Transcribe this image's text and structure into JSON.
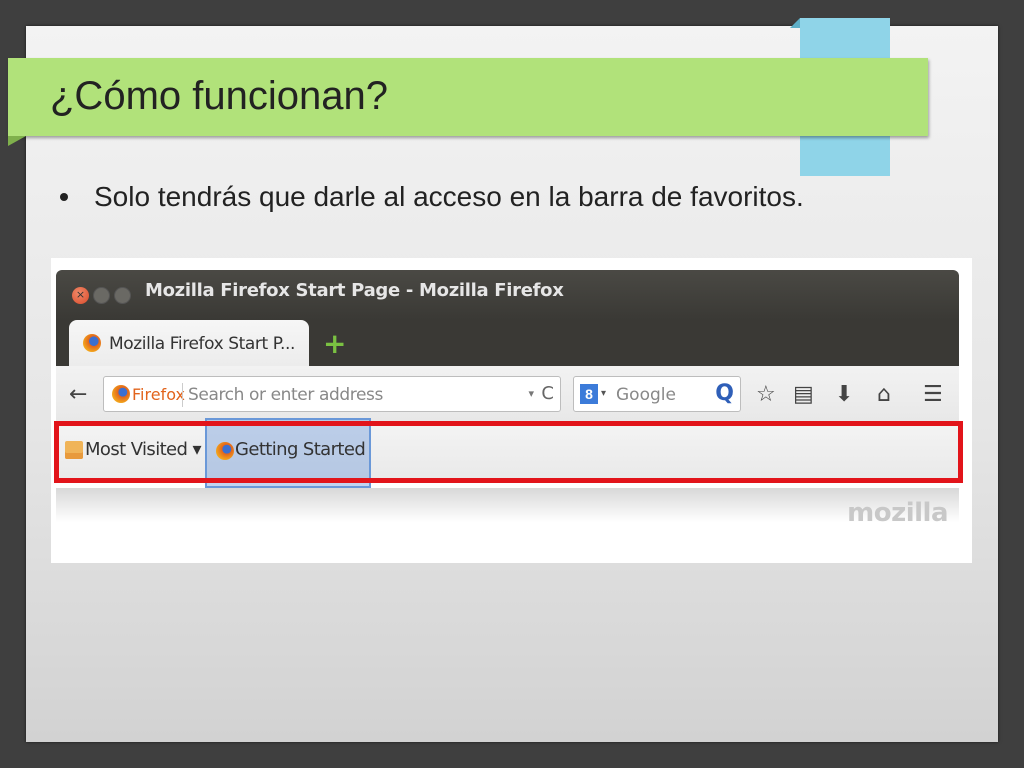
{
  "slide": {
    "title": "¿Cómo funcionan?",
    "bullet": "Solo tendrás que darle al acceso en la barra de  favoritos."
  },
  "browser": {
    "window_title": "Mozilla Firefox Start Page - Mozilla Firefox",
    "tab_label": "Mozilla Firefox Start P...",
    "new_tab_symbol": "+",
    "back_symbol": "←",
    "url_identity_label": "Firefox",
    "url_placeholder": "Search or enter address",
    "url_dropdown_symbol": "▾",
    "reload_symbol": "C",
    "search_engine_badge": "8",
    "search_dropdown_symbol": "▾",
    "search_placeholder": "Google",
    "search_symbol": "Q",
    "toolbar_icons": [
      {
        "name": "bookmark-star-icon",
        "glyph": "☆"
      },
      {
        "name": "bookmarks-menu-icon",
        "glyph": "▤"
      },
      {
        "name": "downloads-icon",
        "glyph": "⬇"
      },
      {
        "name": "home-icon",
        "glyph": "⌂"
      },
      {
        "name": "menu-icon",
        "glyph": "☰"
      }
    ],
    "bookmarks": {
      "most_visited": "Most Visited ▾",
      "getting_started": "Getting Started"
    },
    "brand": "mozilla"
  },
  "colors": {
    "title_bar": "#b1e27a",
    "accent_tab": "#8fd4e8",
    "highlight_border": "#e2141a",
    "selection": "#6a98d8"
  }
}
